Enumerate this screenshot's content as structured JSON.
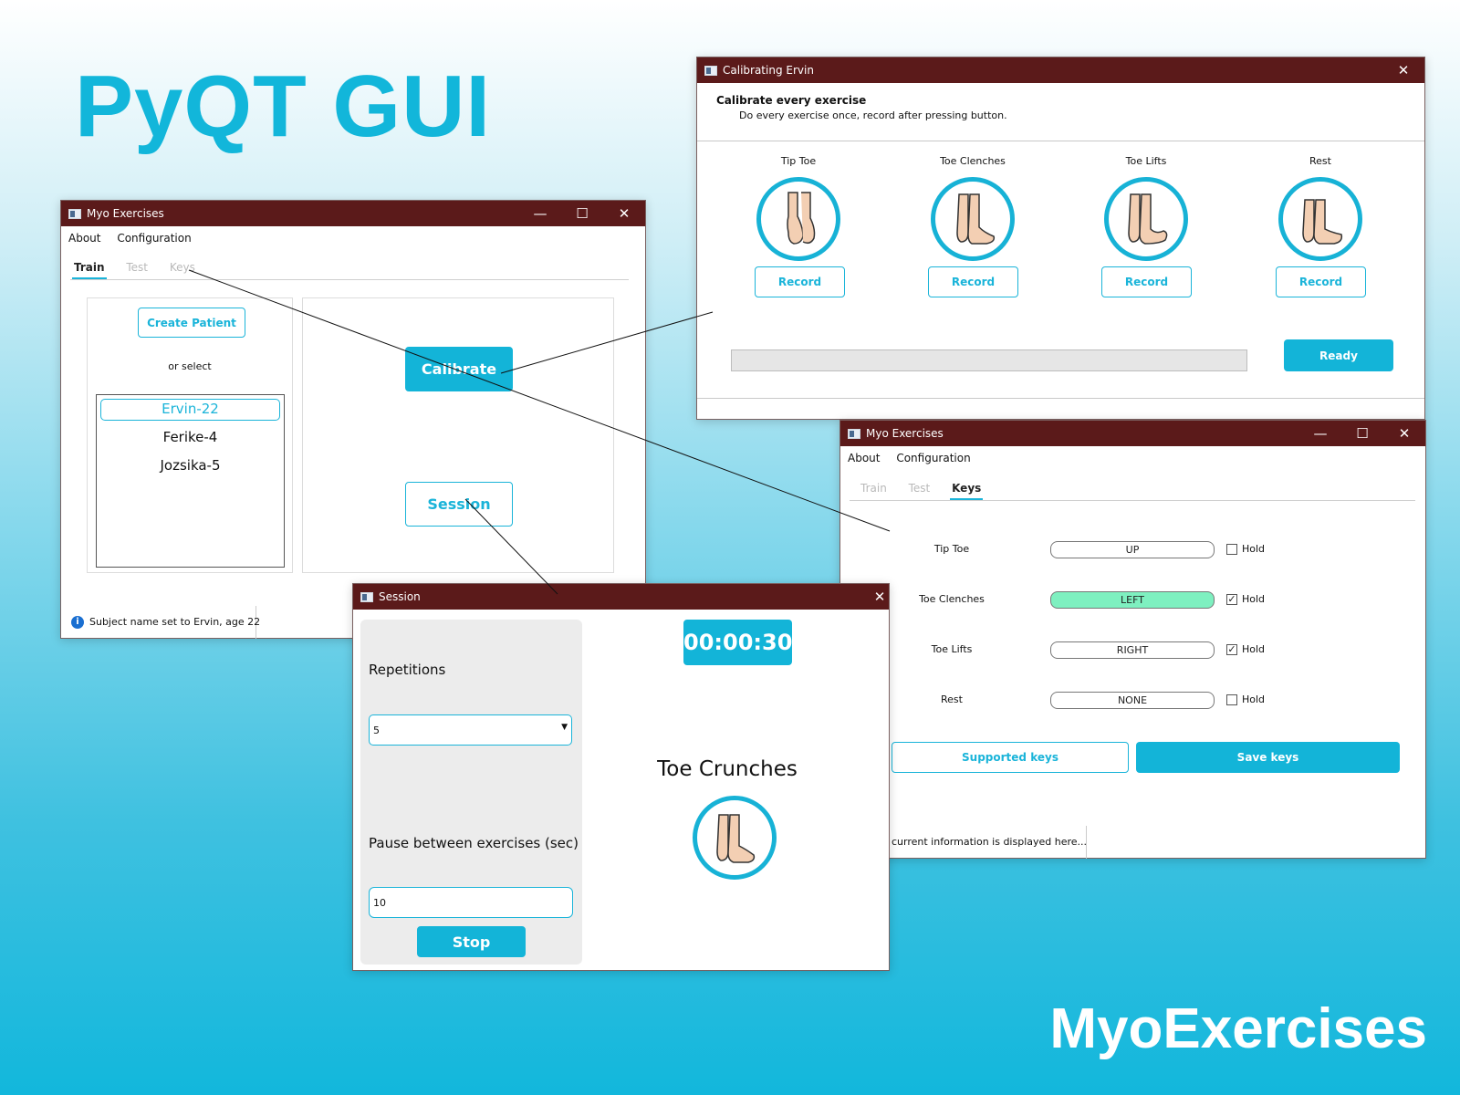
{
  "slide": {
    "title": "PyQT GUI",
    "footer": "MyoExercises"
  },
  "main_window": {
    "title": "Myo Exercises",
    "menu": [
      "About",
      "Configuration"
    ],
    "tabs": [
      "Train",
      "Test",
      "Keys"
    ],
    "active_tab": "Train",
    "create_patient_label": "Create Patient",
    "or_select_label": "or select",
    "patients": [
      "Ervin-22",
      "Ferike-4",
      "Jozsika-5"
    ],
    "selected_patient": "Ervin-22",
    "calibrate_label": "Calibrate",
    "session_label": "Session",
    "status_text": "Subject name set to Ervin, age 22"
  },
  "calibration_window": {
    "title": "Calibrating Ervin",
    "heading": "Calibrate every exercise",
    "instructions": "Do every exercise once, record after pressing button.",
    "exercises": [
      {
        "name": "Tip Toe",
        "icon": "tip-toe-foot-icon",
        "button": "Record"
      },
      {
        "name": "Toe Clenches",
        "icon": "toe-clenches-foot-icon",
        "button": "Record"
      },
      {
        "name": "Toe Lifts",
        "icon": "toe-lifts-foot-icon",
        "button": "Record"
      },
      {
        "name": "Rest",
        "icon": "rest-foot-icon",
        "button": "Record"
      }
    ],
    "ready_label": "Ready",
    "progress": 0
  },
  "keys_window": {
    "title": "Myo Exercises",
    "menu": [
      "About",
      "Configuration"
    ],
    "tabs": [
      "Train",
      "Test",
      "Keys"
    ],
    "active_tab": "Keys",
    "rows": [
      {
        "label": "Tip Toe",
        "key": "UP",
        "hold": false,
        "highlighted": false
      },
      {
        "label": "Toe Clenches",
        "key": "LEFT",
        "hold": true,
        "highlighted": true
      },
      {
        "label": "Toe Lifts",
        "key": "RIGHT",
        "hold": true,
        "highlighted": false
      },
      {
        "label": "Rest",
        "key": "NONE",
        "hold": false,
        "highlighted": false
      }
    ],
    "hold_label": "Hold",
    "supported_keys_label": "Supported keys",
    "save_keys_label": "Save keys",
    "status_text": "current information is displayed here..."
  },
  "session_window": {
    "title": "Session",
    "repetitions_label": "Repetitions",
    "repetitions_value": "5",
    "pause_label": "Pause between exercises (sec)",
    "pause_value": "10",
    "stop_label": "Stop",
    "timer": "00:00:30",
    "current_exercise": "Toe Crunches",
    "current_icon": "toe-crunches-foot-icon"
  },
  "colors": {
    "accent": "#13b4d8",
    "titlebar": "#5b1a1a",
    "highlight_key": "#7ef0c0"
  }
}
